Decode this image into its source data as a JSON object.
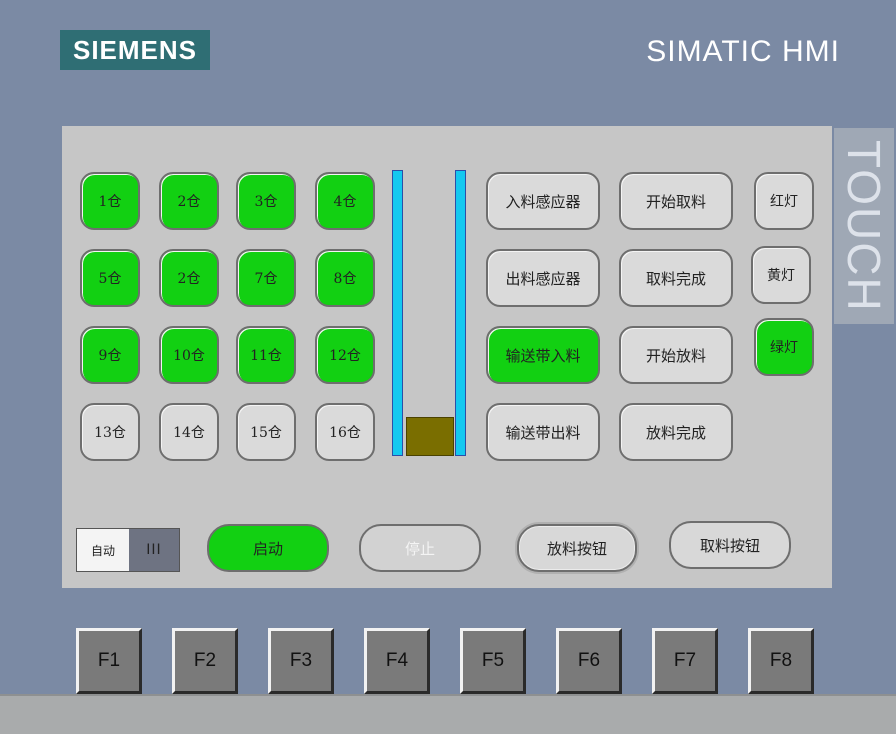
{
  "header": {
    "brand": "SIEMENS",
    "title": "SIMATIC HMI",
    "touch_label": "TOUCH"
  },
  "colors": {
    "active_green": "#12d012",
    "inactive_gray": "#dadada",
    "bar_cyan": "#14c8f0",
    "block_olive": "#7a6e00"
  },
  "bins": [
    {
      "label": "1仓",
      "active": true
    },
    {
      "label": "2仓",
      "active": true
    },
    {
      "label": "3仓",
      "active": true
    },
    {
      "label": "4仓",
      "active": true
    },
    {
      "label": "5仓",
      "active": true
    },
    {
      "label": "2仓",
      "active": true
    },
    {
      "label": "7仓",
      "active": true
    },
    {
      "label": "8仓",
      "active": true
    },
    {
      "label": "9仓",
      "active": true
    },
    {
      "label": "10仓",
      "active": true
    },
    {
      "label": "11仓",
      "active": true
    },
    {
      "label": "12仓",
      "active": true
    },
    {
      "label": "13仓",
      "active": false
    },
    {
      "label": "14仓",
      "active": false
    },
    {
      "label": "15仓",
      "active": false
    },
    {
      "label": "16仓",
      "active": false
    }
  ],
  "sensors": [
    {
      "label": "入料感应器",
      "active": false
    },
    {
      "label": "出料感应器",
      "active": false
    },
    {
      "label": "输送带入料",
      "active": true
    },
    {
      "label": "输送带出料",
      "active": false
    }
  ],
  "operations": [
    {
      "label": "开始取料",
      "active": false
    },
    {
      "label": "取料完成",
      "active": false
    },
    {
      "label": "开始放料",
      "active": false
    },
    {
      "label": "放料完成",
      "active": false
    }
  ],
  "lamps": [
    {
      "label": "红灯",
      "active": false
    },
    {
      "label": "黄灯",
      "active": false
    },
    {
      "label": "绿灯",
      "active": true
    }
  ],
  "controls": {
    "mode_label": "自动",
    "mode_knob": "III",
    "start": "启动",
    "stop": "停止",
    "discharge_button": "放料按钮",
    "pickup_button": "取料按钮"
  },
  "function_keys": [
    "F1",
    "F2",
    "F3",
    "F4",
    "F5",
    "F6",
    "F7",
    "F8"
  ]
}
